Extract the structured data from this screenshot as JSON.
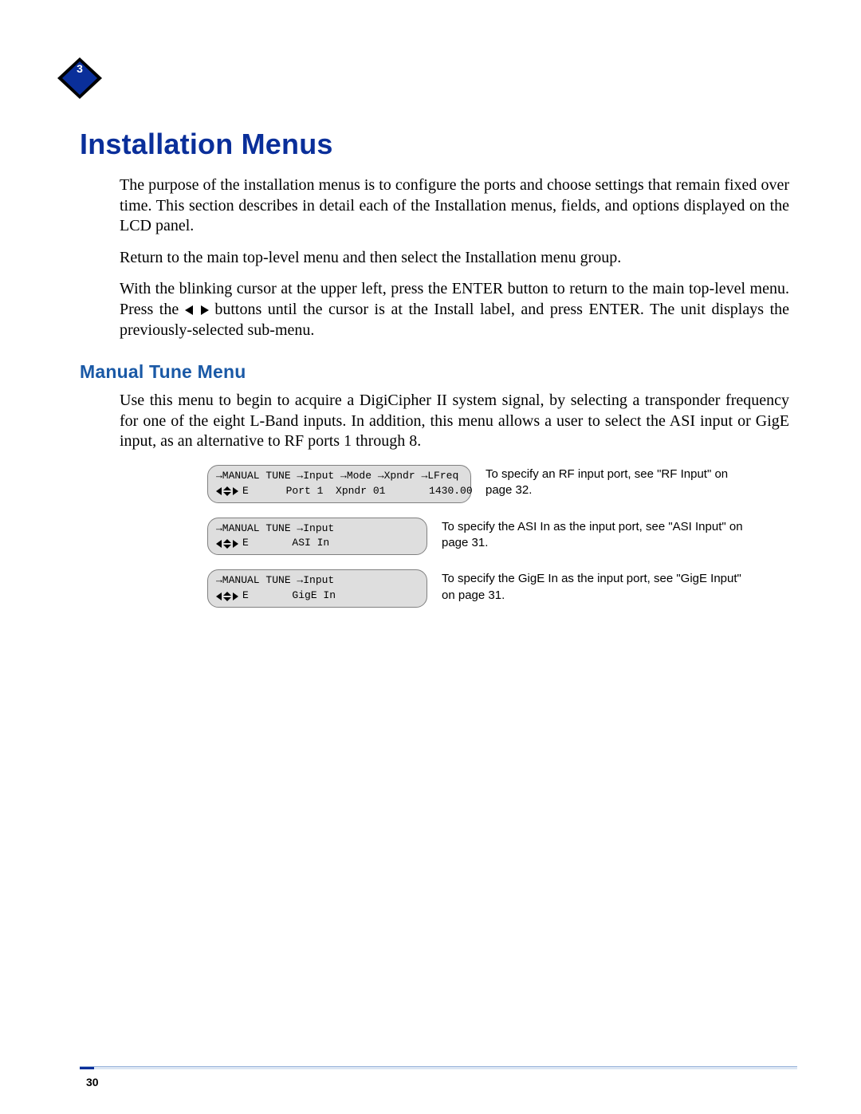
{
  "chapter_marker": "3",
  "title": "Installation Menus",
  "paragraphs": {
    "p1": "The purpose of the installation menus is to configure the ports and choose settings that remain fixed over time. This section describes in detail each of the Installation menus, fields, and options displayed on the LCD panel.",
    "p2": "Return to the main top-level menu and then select the Installation menu group.",
    "p3_pre": "With the blinking cursor at the upper left, press the ENTER button to return to the main top-level menu. Press the ",
    "p3_post": " buttons until the cursor is at the Install label, and press ENTER. The unit displays the previously-selected sub-menu."
  },
  "subhead": "Manual Tune Menu",
  "subtext": "Use this menu to begin to acquire a DigiCipher II system signal, by selecting a transponder frequency for one of the eight L-Band inputs. In addition, this menu allows a user to select the ASI input or GigE input, as an alternative to RF ports 1 through 8.",
  "lcd_rows": [
    {
      "line1": "→MANUAL TUNE →Input →Mode →Xpndr →LFreq",
      "line2_text": "E      Port 1  Xpndr 01       1430.00",
      "desc": "To specify an RF input port, see \"RF Input\" on page 32.",
      "width": "wide"
    },
    {
      "line1": "→MANUAL TUNE →Input",
      "line2_text": "E       ASI In",
      "desc": "To specify the ASI In as the input port, see \"ASI Input\" on page 31.",
      "width": "med"
    },
    {
      "line1": "→MANUAL TUNE →Input",
      "line2_text": "E       GigE In",
      "desc": "To specify the GigE In as the input port, see \"GigE Input\" on page 31.",
      "width": "med"
    }
  ],
  "page_number": "30"
}
